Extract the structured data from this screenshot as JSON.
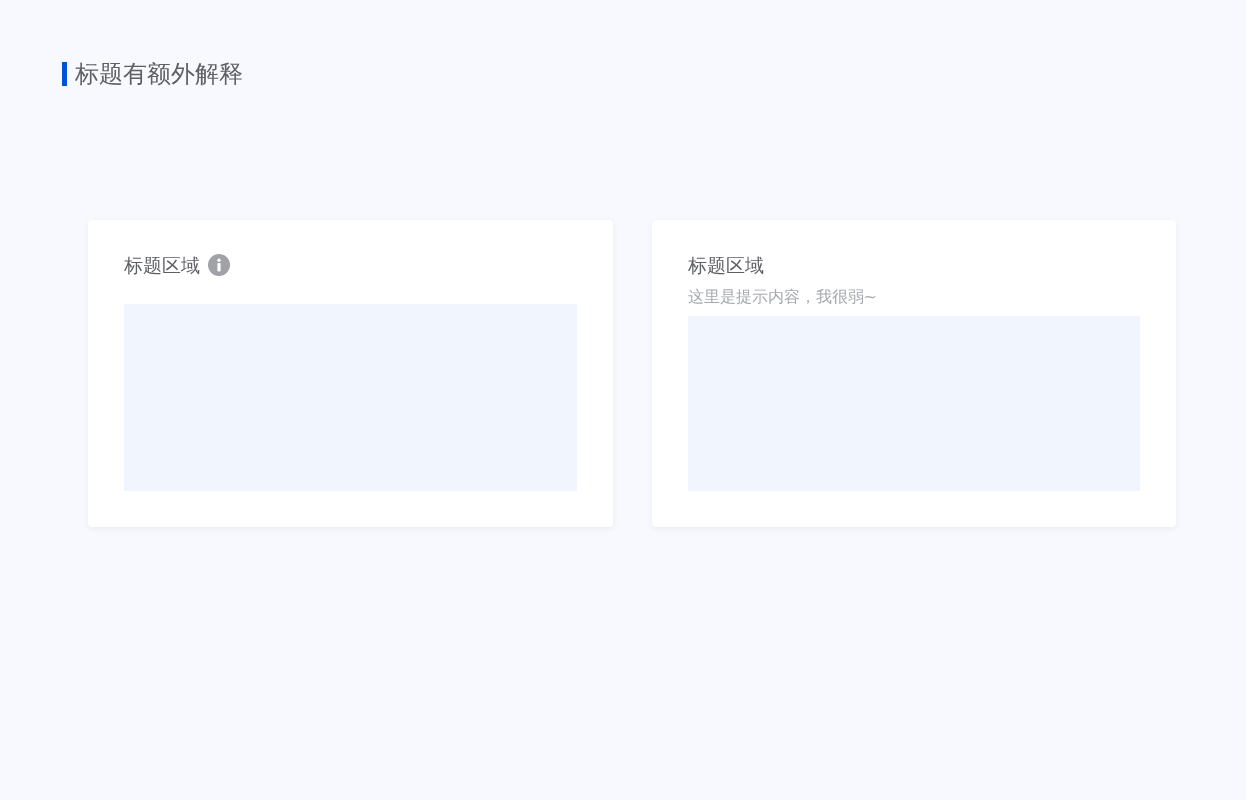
{
  "heading": "标题有额外解释",
  "cards": [
    {
      "kind": "info",
      "title": "标题区域"
    },
    {
      "kind": "hint",
      "title": "标题区域",
      "hint": "这里是提示内容，我很弱~"
    }
  ]
}
